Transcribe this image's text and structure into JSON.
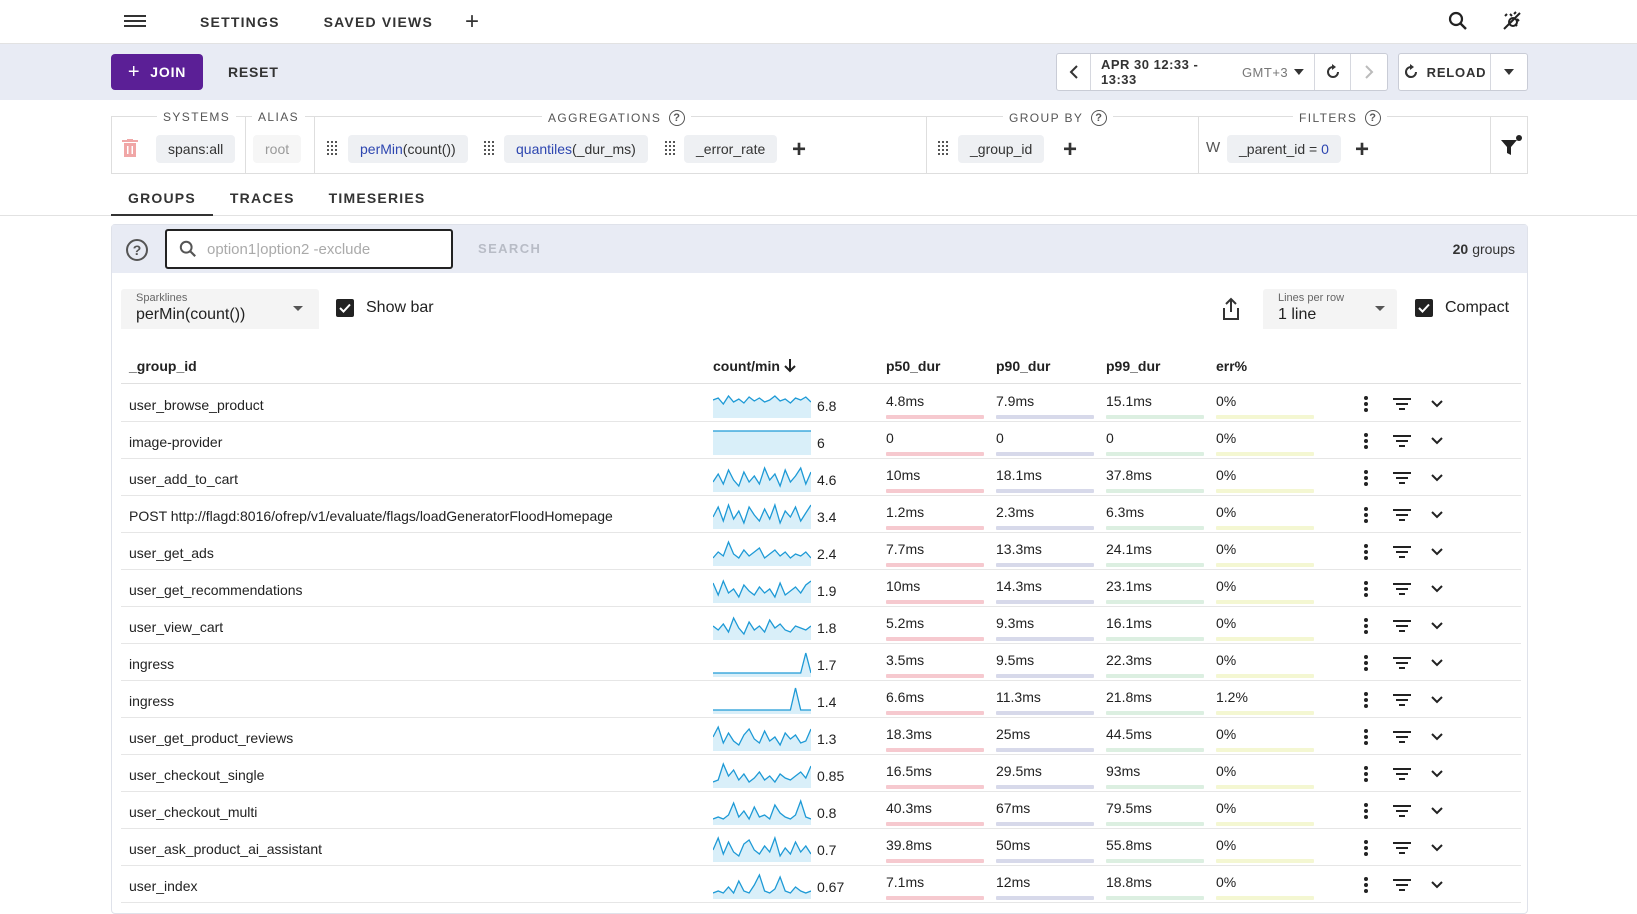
{
  "nav": {
    "settings": "SETTINGS",
    "saved_views": "SAVED VIEWS",
    "add": "+"
  },
  "toolbar": {
    "join": "JOIN",
    "reset": "RESET",
    "time_range": "APR 30 12:33 - 13:33",
    "timezone": "GMT+3",
    "reload": "RELOAD"
  },
  "query": {
    "systems_label": "SYSTEMS",
    "alias_label": "ALIAS",
    "aggregations_label": "AGGREGATIONS",
    "group_by_label": "GROUP BY",
    "filters_label": "FILTERS",
    "system": "spans:all",
    "alias": "root",
    "agg1_fn": "perMin",
    "agg1_arg": "(count())",
    "agg2_fn": "quantiles",
    "agg2_arg": "(_dur_ms)",
    "agg3": "_error_rate",
    "group_by": "_group_id",
    "filter_prefix": "W",
    "filter_key": "_parent_id",
    "filter_op": " = ",
    "filter_val": "0"
  },
  "tabs": [
    "GROUPS",
    "TRACES",
    "TIMESERIES"
  ],
  "search": {
    "placeholder": "option1|option2 -exclude",
    "button": "SEARCH",
    "count": "20",
    "count_suffix": "groups"
  },
  "controls": {
    "sparklines_label": "Sparklines",
    "sparklines_value": "perMin(count())",
    "show_bar": "Show bar",
    "lines_label": "Lines per row",
    "lines_value": "1 line",
    "compact": "Compact"
  },
  "columns": {
    "group": "_group_id",
    "count": "count/min",
    "p50": "p50_dur",
    "p90": "p90_dur",
    "p99": "p99_dur",
    "err": "err%"
  },
  "colors": {
    "accent": "#5b1f96",
    "spark": "#1e9ad6",
    "spark_fill": "#d9eff9",
    "p50_bar": "#f6c9cf",
    "p90_bar": "#d7d9ea",
    "p99_bar": "#dcefe1",
    "err_bar": "#f4f7d2"
  },
  "rows": [
    {
      "name": "user_browse_product",
      "count": "6.8",
      "p50": "4.8ms",
      "p90": "7.9ms",
      "p99": "15.1ms",
      "err": "0%"
    },
    {
      "name": "image-provider",
      "count": "6",
      "p50": "0",
      "p90": "0",
      "p99": "0",
      "err": "0%"
    },
    {
      "name": "user_add_to_cart",
      "count": "4.6",
      "p50": "10ms",
      "p90": "18.1ms",
      "p99": "37.8ms",
      "err": "0%"
    },
    {
      "name": "POST http://flagd:8016/ofrep/v1/evaluate/flags/loadGeneratorFloodHomepage",
      "count": "3.4",
      "p50": "1.2ms",
      "p90": "2.3ms",
      "p99": "6.3ms",
      "err": "0%"
    },
    {
      "name": "user_get_ads",
      "count": "2.4",
      "p50": "7.7ms",
      "p90": "13.3ms",
      "p99": "24.1ms",
      "err": "0%"
    },
    {
      "name": "user_get_recommendations",
      "count": "1.9",
      "p50": "10ms",
      "p90": "14.3ms",
      "p99": "23.1ms",
      "err": "0%"
    },
    {
      "name": "user_view_cart",
      "count": "1.8",
      "p50": "5.2ms",
      "p90": "9.3ms",
      "p99": "16.1ms",
      "err": "0%"
    },
    {
      "name": "ingress",
      "count": "1.7",
      "p50": "3.5ms",
      "p90": "9.5ms",
      "p99": "22.3ms",
      "err": "0%"
    },
    {
      "name": "ingress",
      "count": "1.4",
      "p50": "6.6ms",
      "p90": "11.3ms",
      "p99": "21.8ms",
      "err": "1.2%"
    },
    {
      "name": "user_get_product_reviews",
      "count": "1.3",
      "p50": "18.3ms",
      "p90": "25ms",
      "p99": "44.5ms",
      "err": "0%"
    },
    {
      "name": "user_checkout_single",
      "count": "0.85",
      "p50": "16.5ms",
      "p90": "29.5ms",
      "p99": "93ms",
      "err": "0%"
    },
    {
      "name": "user_checkout_multi",
      "count": "0.8",
      "p50": "40.3ms",
      "p90": "67ms",
      "p99": "79.5ms",
      "err": "0%"
    },
    {
      "name": "user_ask_product_ai_assistant",
      "count": "0.7",
      "p50": "39.8ms",
      "p90": "50ms",
      "p99": "55.8ms",
      "err": "0%"
    },
    {
      "name": "user_index",
      "count": "0.67",
      "p50": "7.1ms",
      "p90": "12ms",
      "p99": "18.8ms",
      "err": "0%"
    }
  ]
}
